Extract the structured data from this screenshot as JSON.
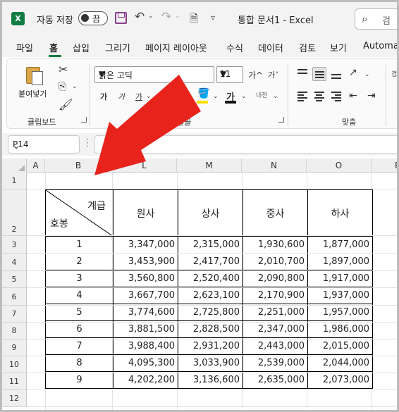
{
  "titlebar": {
    "autosave_label": "자동 저장",
    "autosave_state": "끔",
    "doc_title": "통합 문서1  -  Excel",
    "search_text": "검"
  },
  "menu": {
    "tabs": [
      "파일",
      "홈",
      "삽입",
      "그리기",
      "페이지 레이아웃",
      "수식",
      "데이터",
      "검토",
      "보기",
      "Automat"
    ],
    "active": "홈"
  },
  "ribbon": {
    "clipboard_label": "클립보드",
    "paste_label": "붙여넣기",
    "font_name": "맑은 고딕",
    "font_size": "11",
    "font_group_label": "글꼴",
    "align_group_label": "맞춤",
    "grow_label": "가^",
    "shrink_label": "가ˇ",
    "bold_label": "가",
    "italic_label": "가",
    "underline_label": "가",
    "fontcolor_label": "가",
    "phonetic_label": "내천"
  },
  "formula_bar": {
    "name_box": "P14",
    "formula": ""
  },
  "grid": {
    "columns": [
      "A",
      "B",
      "L",
      "M",
      "N",
      "O",
      "P"
    ],
    "rows": [
      "1",
      "2",
      "3",
      "4",
      "5",
      "6",
      "7",
      "8",
      "9",
      "10",
      "11",
      "12"
    ]
  },
  "table": {
    "corner_top": "계급",
    "corner_bottom": "호봉",
    "headers": [
      "원사",
      "상사",
      "중사",
      "하사"
    ],
    "rows": [
      {
        "step": "1",
        "values": [
          "3,347,000",
          "2,315,000",
          "1,930,600",
          "1,877,000"
        ]
      },
      {
        "step": "2",
        "values": [
          "3,453,900",
          "2,417,700",
          "2,010,700",
          "1,897,000"
        ]
      },
      {
        "step": "3",
        "values": [
          "3,560,800",
          "2,520,400",
          "2,090,800",
          "1,917,000"
        ]
      },
      {
        "step": "4",
        "values": [
          "3,667,700",
          "2,623,100",
          "2,170,900",
          "1,937,000"
        ]
      },
      {
        "step": "5",
        "values": [
          "3,774,600",
          "2,725,800",
          "2,251,000",
          "1,957,000"
        ]
      },
      {
        "step": "6",
        "values": [
          "3,881,500",
          "2,828,500",
          "2,347,000",
          "1,986,000"
        ]
      },
      {
        "step": "7",
        "values": [
          "3,988,400",
          "2,931,200",
          "2,443,000",
          "2,015,000"
        ]
      },
      {
        "step": "8",
        "values": [
          "4,095,300",
          "3,033,900",
          "2,539,000",
          "2,044,000"
        ]
      },
      {
        "step": "9",
        "values": [
          "4,202,200",
          "3,136,600",
          "2,635,000",
          "2,073,000"
        ]
      }
    ]
  },
  "colors": {
    "excel_green": "#107c41",
    "arrow_red": "#e8231c",
    "save_purple": "#8a3d8f"
  }
}
